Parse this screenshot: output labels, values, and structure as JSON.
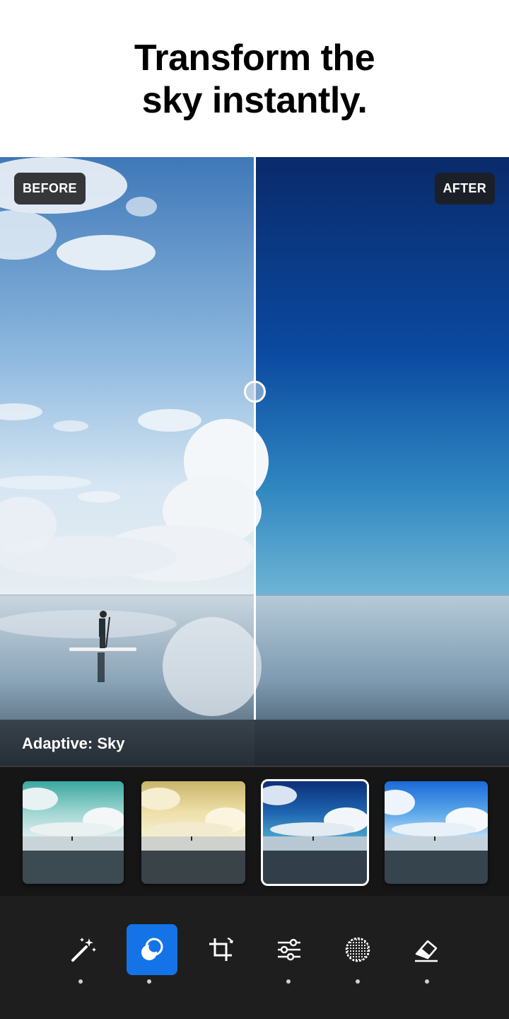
{
  "headline": {
    "line1": "Transform the",
    "line2": "sky instantly."
  },
  "compare": {
    "before_label": "BEFORE",
    "after_label": "AFTER"
  },
  "adaptive": {
    "label": "Adaptive: Sky"
  },
  "presets": [
    {
      "name": "teal-sky",
      "selected": false
    },
    {
      "name": "golden-sky",
      "selected": false
    },
    {
      "name": "deep-blue-sky",
      "selected": true
    },
    {
      "name": "bright-blue-sky",
      "selected": false
    }
  ],
  "toolbar": {
    "tools": [
      {
        "icon": "magic-wand-icon",
        "active": false
      },
      {
        "icon": "masking-icon",
        "active": true
      },
      {
        "icon": "crop-icon",
        "active": false
      },
      {
        "icon": "adjust-sliders-icon",
        "active": false
      },
      {
        "icon": "vignette-icon",
        "active": false
      },
      {
        "icon": "eraser-icon",
        "active": false
      }
    ]
  },
  "colors": {
    "accent": "#1473e6",
    "toolbar_bg": "#1e1e1e",
    "before_sky_top": "#3f78b8",
    "before_sky_bottom": "#d6e6f2",
    "after_sky_top": "#0a2a6a",
    "after_sky_bottom": "#3a9cc6"
  }
}
